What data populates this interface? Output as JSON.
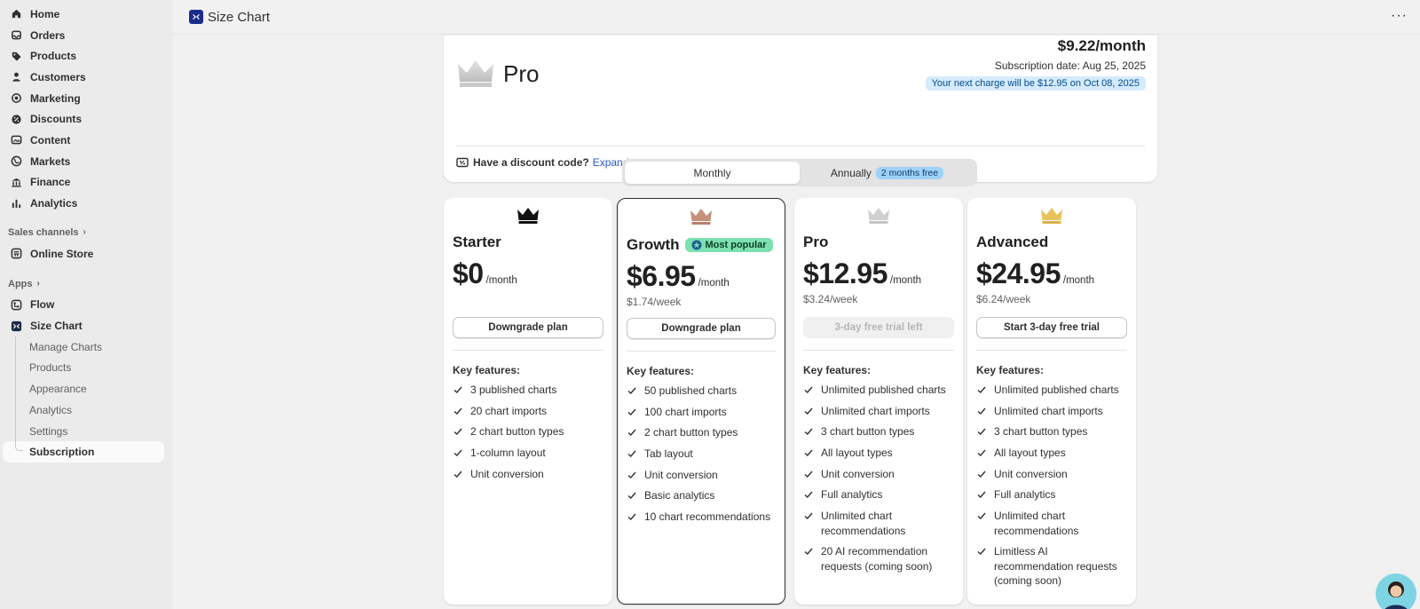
{
  "sidebar": {
    "nav": [
      {
        "label": "Home",
        "icon": "home-icon"
      },
      {
        "label": "Orders",
        "icon": "inbox-icon"
      },
      {
        "label": "Products",
        "icon": "tag-icon"
      },
      {
        "label": "Customers",
        "icon": "person-icon"
      },
      {
        "label": "Marketing",
        "icon": "target-icon"
      },
      {
        "label": "Discounts",
        "icon": "discount-icon"
      },
      {
        "label": "Content",
        "icon": "image-icon"
      },
      {
        "label": "Markets",
        "icon": "globe-icon"
      },
      {
        "label": "Finance",
        "icon": "bank-icon"
      },
      {
        "label": "Analytics",
        "icon": "bar-chart-icon"
      }
    ],
    "sales_channels_label": "Sales channels",
    "online_store": "Online Store",
    "apps_label": "Apps",
    "flow": "Flow",
    "size_chart": "Size Chart",
    "sub_items": [
      "Manage Charts",
      "Products",
      "Appearance",
      "Analytics",
      "Settings"
    ],
    "active_sub": "Subscription"
  },
  "topbar": {
    "title": "Size Chart"
  },
  "current_plan": {
    "name": "Pro",
    "price": "$9.22/month",
    "subscription_date": "Subscription date: Aug 25, 2025",
    "next_charge": "Your next charge will be $12.95 on Oct 08, 2025",
    "discount_label": "Have a discount code?",
    "expand_label": "Expand"
  },
  "billing_toggle": {
    "monthly": "Monthly",
    "annually": "Annually",
    "annual_badge": "2 months free"
  },
  "plans": [
    {
      "name": "Starter",
      "price": "$0",
      "per_month": "/month",
      "per_week": "",
      "button": "Downgrade plan",
      "key_features_label": "Key features:",
      "features": [
        "3 published charts",
        "20 chart imports",
        "2 chart button types",
        "1-column layout",
        "Unit conversion"
      ]
    },
    {
      "name": "Growth",
      "badge": "Most popular",
      "price": "$6.95",
      "per_month": "/month",
      "per_week": "$1.74/week",
      "button": "Downgrade plan",
      "key_features_label": "Key features:",
      "features": [
        "50 published charts",
        "100 chart imports",
        "2 chart button types",
        "Tab layout",
        "Unit conversion",
        "Basic analytics",
        "10 chart recommendations"
      ]
    },
    {
      "name": "Pro",
      "price": "$12.95",
      "per_month": "/month",
      "per_week": "$3.24/week",
      "button": "3-day free trial left",
      "key_features_label": "Key features:",
      "features": [
        "Unlimited published charts",
        "Unlimited chart imports",
        "3 chart button types",
        "All layout types",
        "Unit conversion",
        "Full analytics",
        "Unlimited chart recommendations",
        "20 AI recommendation requests (coming soon)"
      ]
    },
    {
      "name": "Advanced",
      "price": "$24.95",
      "per_month": "/month",
      "per_week": "$6.24/week",
      "button": "Start 3-day free trial",
      "key_features_label": "Key features:",
      "features": [
        "Unlimited published charts",
        "Unlimited chart imports",
        "3 chart button types",
        "All layout types",
        "Unit conversion",
        "Full analytics",
        "Unlimited chart recommendations",
        "Limitless AI recommendation requests (coming soon)"
      ]
    }
  ],
  "colors": {
    "crown_starter": "#111111",
    "crown_growth": "#c4907a",
    "crown_pro": "#d0d0d0",
    "crown_advanced": "#e8c35a",
    "link": "#2c57c8",
    "popular_badge": "#7ce0b0",
    "annual_badge": "#9ed2f8"
  }
}
